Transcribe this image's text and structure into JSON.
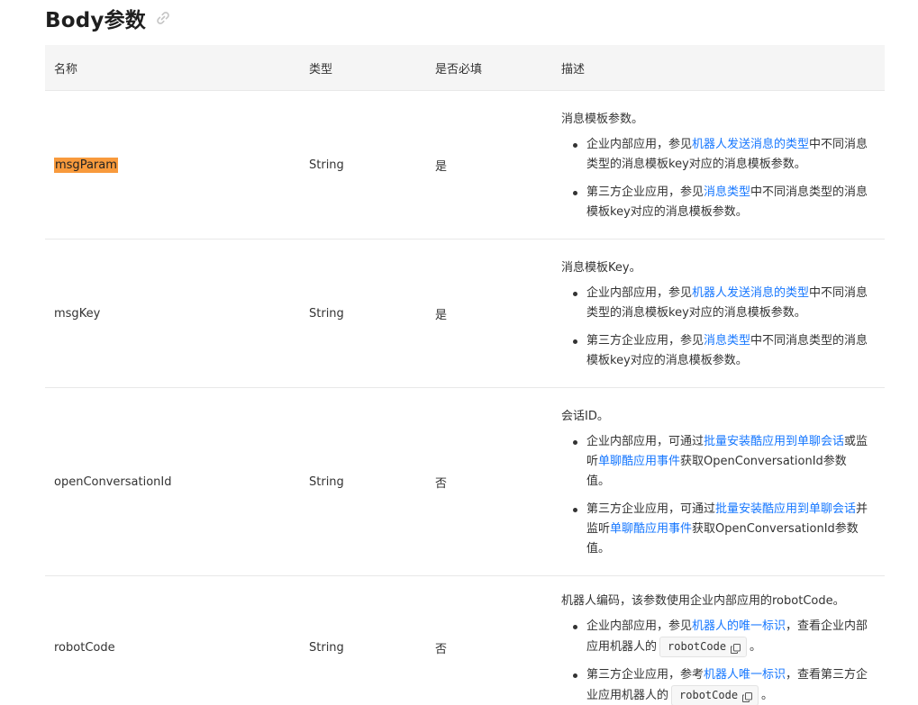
{
  "heading": {
    "title": "Body参数"
  },
  "table": {
    "headers": [
      "名称",
      "类型",
      "是否必填",
      "描述"
    ],
    "rows": [
      {
        "name": "msgParam",
        "type": "String",
        "required": "是",
        "intro": "消息模板参数。",
        "bullets": [
          [
            {
              "t": "企业内部应用，参见"
            },
            {
              "t": "机器人发送消息的类型",
              "link": true
            },
            {
              "t": "中不同消息类型的消息模板key对应的消息模板参数。"
            }
          ],
          [
            {
              "t": "第三方企业应用，参见"
            },
            {
              "t": "消息类型",
              "link": true
            },
            {
              "t": "中不同消息类型的消息模板key对应的消息模板参数。"
            }
          ]
        ]
      },
      {
        "name": "msgKey",
        "type": "String",
        "required": "是",
        "intro": "消息模板Key。",
        "bullets": [
          [
            {
              "t": "企业内部应用，参见"
            },
            {
              "t": "机器人发送消息的类型",
              "link": true
            },
            {
              "t": "中不同消息类型的消息模板key对应的消息模板参数。"
            }
          ],
          [
            {
              "t": "第三方企业应用，参见"
            },
            {
              "t": "消息类型",
              "link": true
            },
            {
              "t": "中不同消息类型的消息模板key对应的消息模板参数。"
            }
          ]
        ]
      },
      {
        "name": "openConversationId",
        "type": "String",
        "required": "否",
        "intro": "会话ID。",
        "bullets": [
          [
            {
              "t": "企业内部应用，可通过"
            },
            {
              "t": "批量安装酷应用到单聊会话",
              "link": true
            },
            {
              "t": "或监听"
            },
            {
              "t": "单聊酷应用事件",
              "link": true
            },
            {
              "t": "获取OpenConversationId参数值。"
            }
          ],
          [
            {
              "t": "第三方企业应用，可通过"
            },
            {
              "t": "批量安装酷应用到单聊会话",
              "link": true
            },
            {
              "t": "并监听"
            },
            {
              "t": "单聊酷应用事件",
              "link": true
            },
            {
              "t": "获取OpenConversationId参数值。"
            }
          ]
        ]
      },
      {
        "name": "robotCode",
        "type": "String",
        "required": "否",
        "intro": "机器人编码，该参数使用企业内部应用的robotCode。",
        "bullets": [
          [
            {
              "t": "企业内部应用，参见"
            },
            {
              "t": "机器人的唯一标识",
              "link": true
            },
            {
              "t": "，查看企业内部应用机器人的"
            },
            {
              "t": "robotCode",
              "code": true
            },
            {
              "t": "。"
            }
          ],
          [
            {
              "t": "第三方企业应用，参考"
            },
            {
              "t": "机器人唯一标识",
              "link": true
            },
            {
              "t": "，查看第三方企业应用机器人的"
            },
            {
              "t": "robotCode",
              "code": true
            },
            {
              "t": "。"
            }
          ]
        ]
      }
    ]
  },
  "icons": {
    "heading_link": "link-icon",
    "code_copy": "copy-icon"
  },
  "colors": {
    "link": "#1677ff",
    "highlight": "#f89a3c",
    "header_bg": "#f5f5f5"
  }
}
